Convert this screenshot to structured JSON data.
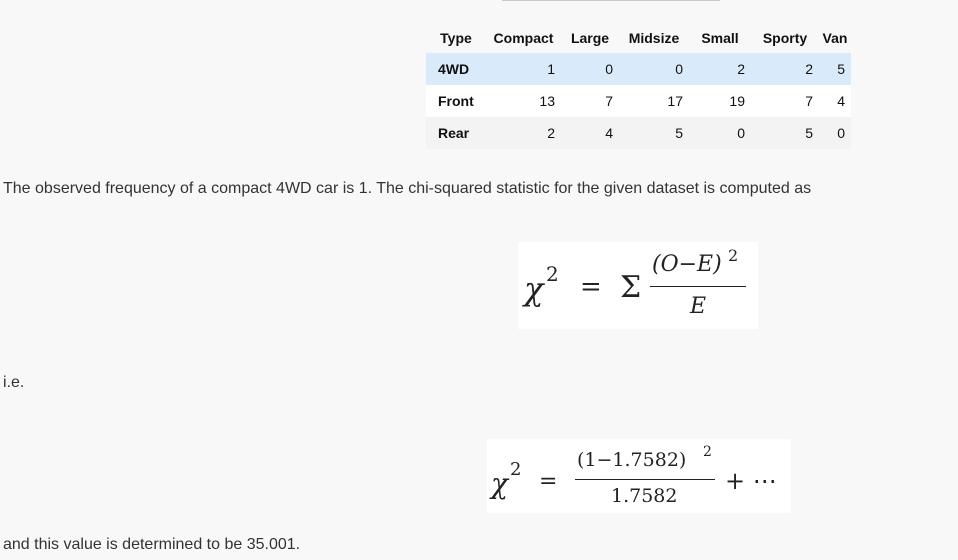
{
  "table": {
    "corner": "Type",
    "columns": [
      "Compact",
      "Large",
      "Midsize",
      "Small",
      "Sporty",
      "Van"
    ],
    "rows": [
      {
        "label": "4WD",
        "values": [
          "1",
          "0",
          "0",
          "2",
          "2",
          "5"
        ]
      },
      {
        "label": "Front",
        "values": [
          "13",
          "7",
          "17",
          "19",
          "7",
          "4"
        ]
      },
      {
        "label": "Rear",
        "values": [
          "2",
          "4",
          "5",
          "0",
          "5",
          "0"
        ]
      }
    ]
  },
  "text": {
    "intro": "The observed frequency of a compact 4WD car is 1. The chi-squared statistic for the given dataset is computed as",
    "ie": "i.e.",
    "result": "and this value is determined to be 35.001."
  },
  "formula1": {
    "lhs": "χ",
    "exp": "2",
    "eq": "=",
    "sum": "Σ",
    "numerator": "(O−E)",
    "num_exp": "2",
    "denominator": "E"
  },
  "formula2": {
    "lhs": "χ",
    "exp": "2",
    "eq": "=",
    "numerator": "(1−1.7582)",
    "num_exp": "2",
    "denominator": "1.7582",
    "tail": "+ ⋯"
  }
}
